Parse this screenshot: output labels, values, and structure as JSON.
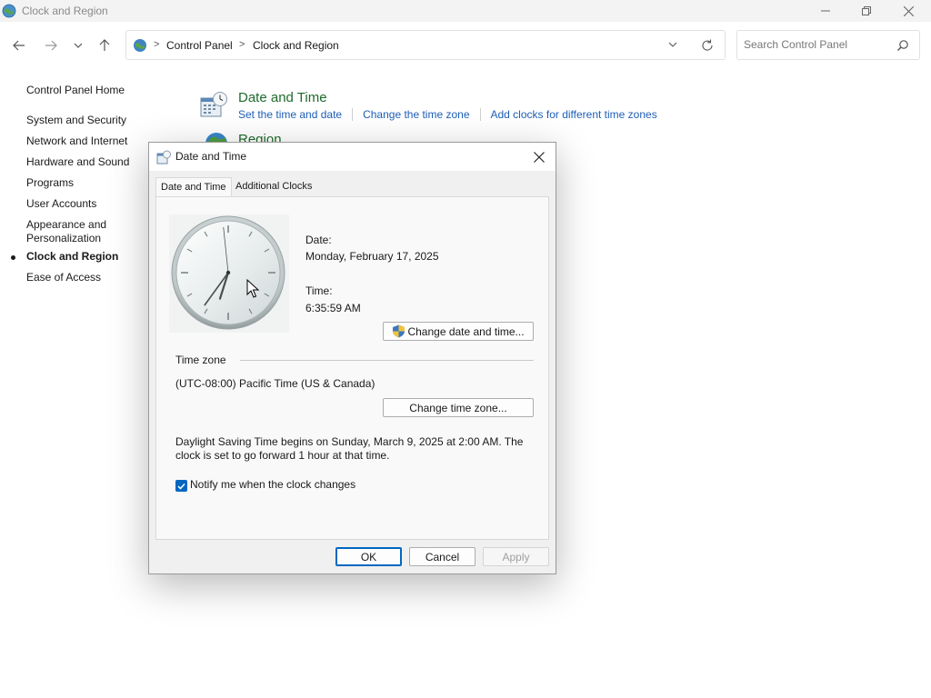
{
  "window": {
    "title": "Clock and Region"
  },
  "nav": {
    "back": "back",
    "forward": "forward",
    "recent": "recent",
    "up": "up"
  },
  "address": {
    "crumbs": [
      "Control Panel",
      "Clock and Region"
    ],
    "separator": ">"
  },
  "search": {
    "placeholder": "Search Control Panel",
    "value": ""
  },
  "sidebar": {
    "items": [
      {
        "label": "Control Panel Home"
      },
      {
        "label": "System and Security"
      },
      {
        "label": "Network and Internet"
      },
      {
        "label": "Hardware and Sound"
      },
      {
        "label": "Programs"
      },
      {
        "label": "User Accounts"
      },
      {
        "label": "Appearance and"
      },
      {
        "label": "Personalization"
      },
      {
        "label": "Clock and Region",
        "active": true
      },
      {
        "label": "Ease of Access"
      }
    ]
  },
  "main": {
    "date_time": {
      "title": "Date and Time",
      "links": [
        "Set the time and date",
        "Change the time zone",
        "Add clocks for different time zones"
      ]
    },
    "region": {
      "title": "Region"
    }
  },
  "dialog": {
    "title": "Date and Time",
    "tabs": [
      "Date and Time",
      "Additional Clocks"
    ],
    "selected_tab": "Date and Time",
    "date_label": "Date:",
    "date_value": "Monday, February 17, 2025",
    "time_label": "Time:",
    "time_value": "6:35:59 AM",
    "change_datetime_button": "Change date and time...",
    "timezone_label": "Time zone",
    "timezone_value": "(UTC-08:00) Pacific Time (US & Canada)",
    "change_timezone_button": "Change time zone...",
    "dst_line1": "Daylight Saving Time begins on Sunday, March 9, 2025 at 2:00 AM. The",
    "dst_line2": "clock is set to go forward 1 hour at that time.",
    "notify_checkbox": {
      "label": "Notify me when the clock changes",
      "checked": true
    },
    "buttons": {
      "ok": "OK",
      "cancel": "Cancel",
      "apply": "Apply"
    },
    "clock": {
      "hour": 6,
      "minute": 35,
      "second": 59
    }
  },
  "colors": {
    "link": "#1f5fb8",
    "category_title": "#1e6b2b",
    "accent": "#0067c0"
  }
}
